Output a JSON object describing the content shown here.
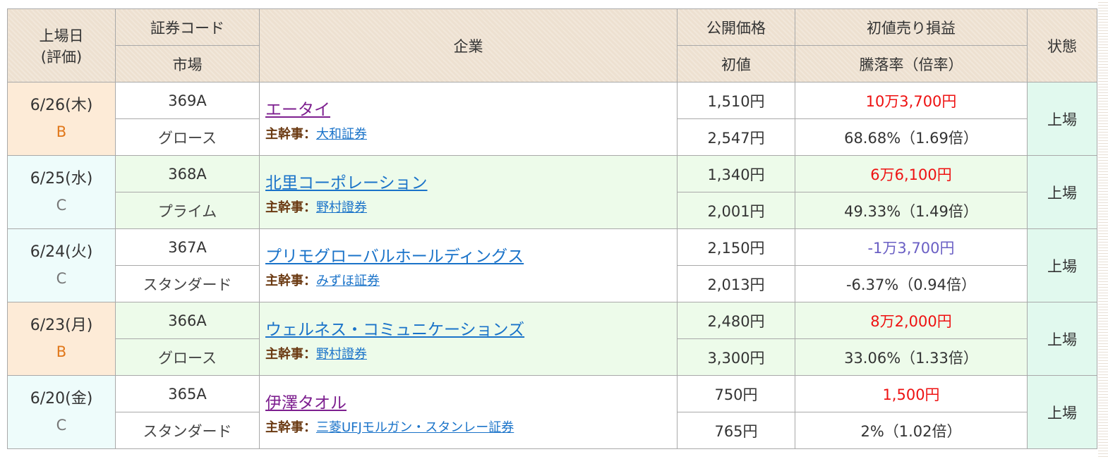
{
  "header": {
    "listing_date": "上場日",
    "rating": "(評価)",
    "code": "証券コード",
    "market": "市場",
    "company": "企業",
    "offer_price": "公開価格",
    "initial_price": "初値",
    "initial_pl": "初値売り損益",
    "change_rate": "騰落率（倍率）",
    "status": "状態"
  },
  "underwriter_label": "主幹事：",
  "rows": [
    {
      "date": "6/26(木)",
      "rating": "B",
      "code": "369A",
      "market": "グロース",
      "company": "エータイ",
      "underwriter": "大和証券",
      "offer_price": "1,510円",
      "initial_price": "2,547円",
      "profit": "10万3,700円",
      "rate": "68.68%（1.69倍）",
      "status": "上場"
    },
    {
      "date": "6/25(水)",
      "rating": "C",
      "code": "368A",
      "market": "プライム",
      "company": "北里コーポレーション",
      "underwriter": "野村證券",
      "offer_price": "1,340円",
      "initial_price": "2,001円",
      "profit": "6万6,100円",
      "rate": "49.33%（1.49倍）",
      "status": "上場"
    },
    {
      "date": "6/24(火)",
      "rating": "C",
      "code": "367A",
      "market": "スタンダード",
      "company": "プリモグローバルホールディングス",
      "underwriter": "みずほ証券",
      "offer_price": "2,150円",
      "initial_price": "2,013円",
      "profit": "-1万3,700円",
      "rate": "-6.37%（0.94倍）",
      "status": "上場"
    },
    {
      "date": "6/23(月)",
      "rating": "B",
      "code": "366A",
      "market": "グロース",
      "company": "ウェルネス・コミュニケーションズ",
      "underwriter": "野村證券",
      "offer_price": "2,480円",
      "initial_price": "3,300円",
      "profit": "8万2,000円",
      "rate": "33.06%（1.33倍）",
      "status": "上場"
    },
    {
      "date": "6/20(金)",
      "rating": "C",
      "code": "365A",
      "market": "スタンダード",
      "company": "伊澤タオル",
      "underwriter": "三菱UFJモルガン・スタンレー証券",
      "offer_price": "750円",
      "initial_price": "765円",
      "profit": "1,500円",
      "rate": "2%（1.02倍）",
      "status": "上場"
    }
  ],
  "colors": {
    "header_bg": "#ede0d0",
    "rating_b_color": "#e0771a",
    "rating_b_bg": "#fdebd7",
    "rating_c_color": "#777777",
    "rating_c_bg": "#eefcfb",
    "row_alt_bg": "#edfbea",
    "status_bg": "#e1f9ee",
    "profit_positive": "#ee1111",
    "profit_negative": "#6a5fc4",
    "link_visited": "#7d1f8f",
    "link": "#1a73c9",
    "underwriter_label": "#6b3a12"
  }
}
